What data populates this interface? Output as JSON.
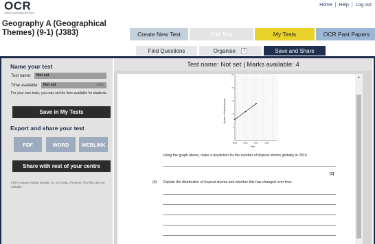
{
  "logo": {
    "text": "OCR",
    "sub": "Oxford Cambridge and RSA"
  },
  "top_links": {
    "home": "Home",
    "help": "Help",
    "logout": "Log out",
    "sep": "|"
  },
  "page_title": "Geography A (Geographical Themes) (9-1) (J383)",
  "main_tabs": {
    "create": "Create New Test",
    "edit": "Edit Test",
    "my_tests": "My Tests",
    "past_papers": "OCR Past Papers"
  },
  "sub_tabs": {
    "find": "Find Questions",
    "organise": "Organise",
    "organise_count": "1",
    "save": "Save and Share"
  },
  "left": {
    "name_heading": "Name your test",
    "test_name_label": "Test name:",
    "test_name_value": "Not set",
    "time_label": "Time available:",
    "time_value": "Not set",
    "time_unit": "mins",
    "time_note": "For your own tests, you may set the time available for students.",
    "save_button": "Save in My Tests",
    "export_heading": "Export and share your test",
    "pdf": "PDF",
    "word": "WORD",
    "weblink": "WEBLINK",
    "share_button": "Share with rest of your centre",
    "footnote": "PDFs require Adobe Reader, or, on a Mac, Preview. The files are not editable."
  },
  "content": {
    "header": "Test name: Not set | Marks available: 4",
    "scroll_up": "▲",
    "question_a": "Using the graph above, make a prediction for the number of tropical storms globally in 2015.",
    "mark_a": "[1]",
    "part_b_label": "(b)",
    "question_b": "Explain the distribution of tropical storms and whether this has changed over time."
  },
  "chart_data": {
    "type": "line",
    "title": "",
    "xlabel": "Year",
    "ylabel": "Number of tropical storms",
    "x": [
      2000,
      2002,
      2004
    ],
    "series": [
      {
        "values": [
          8,
          11,
          14
        ]
      }
    ],
    "xlim": [
      2000,
      2008
    ],
    "ylim": [
      0,
      25
    ],
    "xticks": [
      "2000",
      "2002",
      "2004",
      "2006"
    ],
    "yticks": [
      "5",
      "10",
      "15",
      "20",
      "25"
    ],
    "grid": true
  }
}
